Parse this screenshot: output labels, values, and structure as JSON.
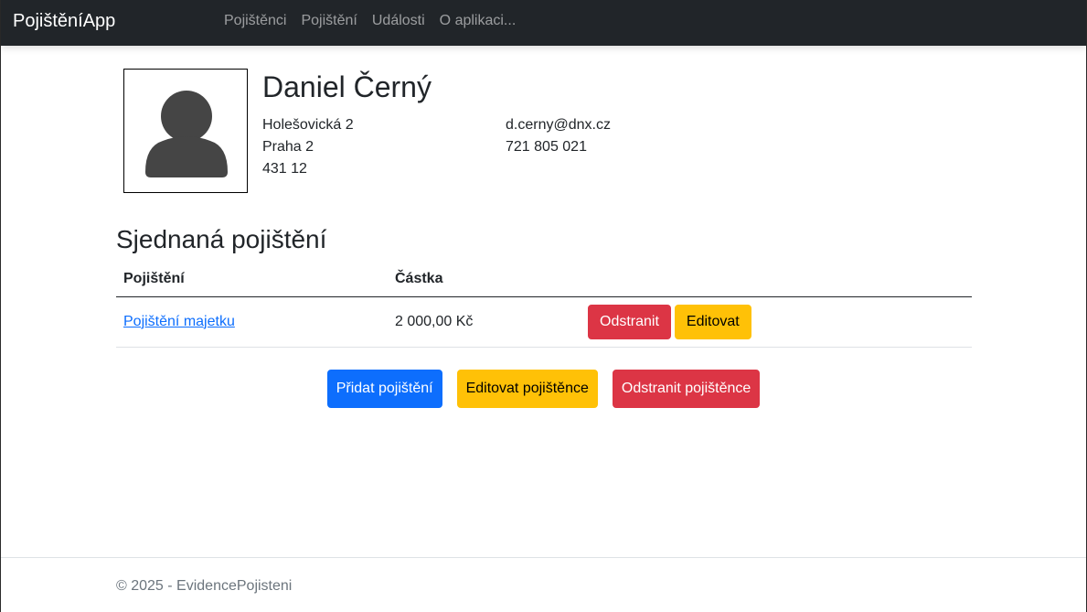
{
  "navbar": {
    "brand": "PojištěníApp",
    "links": [
      "Pojištěnci",
      "Pojištění",
      "Události",
      "O aplikaci..."
    ]
  },
  "person": {
    "name": "Daniel Černý",
    "street": "Holešovická 2",
    "city": "Praha 2",
    "zip": "431 12",
    "email": "d.cerny@dnx.cz",
    "phone": "721 805 021"
  },
  "insurances": {
    "title": "Sjednaná pojištění",
    "headers": [
      "Pojištění",
      "Částka"
    ],
    "rows": [
      {
        "name": "Pojištění majetku",
        "amount": "2 000,00 Kč",
        "delete_label": "Odstranit",
        "edit_label": "Editovat"
      }
    ]
  },
  "actions": {
    "add_label": "Přidat pojištění",
    "edit_label": "Editovat pojištěnce",
    "delete_label": "Odstranit pojištěnce"
  },
  "footer": {
    "text": "© 2025 - EvidencePojisteni"
  },
  "colors": {
    "navbar_bg": "#212529",
    "danger": "#dc3545",
    "warning": "#ffc107",
    "primary": "#0d6efd",
    "link": "#0d6efd"
  },
  "icons": {
    "avatar": "person-silhouette-icon"
  }
}
